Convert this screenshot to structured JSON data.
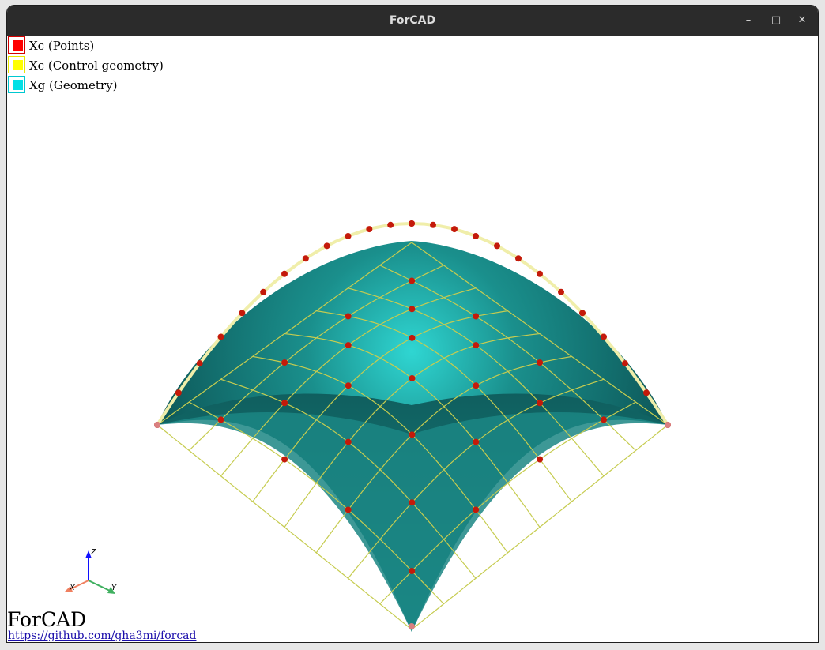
{
  "window": {
    "title": "ForCAD"
  },
  "window_controls": {
    "minimize": "–",
    "maximize": "□",
    "close": "✕"
  },
  "legend": [
    {
      "label": "Xc (Points)",
      "fill": "#ff0000",
      "border": "#d40000"
    },
    {
      "label": "Xc (Control geometry)",
      "fill": "#ffff00",
      "border": "#e6e600"
    },
    {
      "label": "Xg (Geometry)",
      "fill": "#00e0e6",
      "border": "#00c8d0"
    }
  ],
  "axes": {
    "x": "X",
    "y": "Y",
    "z": "Z"
  },
  "footer": {
    "brand": "ForCAD",
    "link": "https://github.com/gha3mi/forcad"
  },
  "colors": {
    "surface": "#1e8886",
    "surface_highlight": "#2fd6d2",
    "grid": "#c6cc50",
    "control_net": "#f0eeaa",
    "control_point": "#c41a0a"
  }
}
